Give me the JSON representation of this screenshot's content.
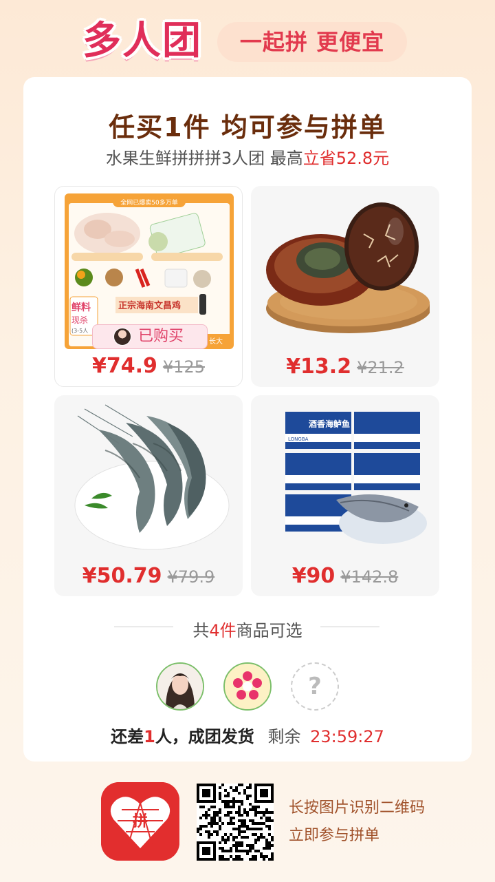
{
  "header": {
    "logo": "多人团",
    "slogan": "一起拼 更便宜"
  },
  "title": "任买1件 均可参与拼单",
  "subtitle": {
    "prefix": "水果生鲜拼拼拼3人团 最高",
    "highlight": "立省52.8元"
  },
  "products": [
    {
      "name": "chicken-combo",
      "price": "¥74.9",
      "original": "¥125",
      "bought_label": "已购买",
      "selected": true,
      "banner": "全网已爆卖50多万单",
      "tag1": "鲜料",
      "tag2": "现杀",
      "tag3": "(3-5人",
      "tag4": "长大",
      "product_title": "正宗海南文昌鸡"
    },
    {
      "name": "preserved-egg",
      "price": "¥13.2",
      "original": "¥21.2"
    },
    {
      "name": "shrimp",
      "price": "¥50.79",
      "original": "¥79.9"
    },
    {
      "name": "sea-bass",
      "price": "¥90",
      "original": "¥142.8",
      "box_label": "酒香海鲈鱼",
      "box_code": "LONGBA"
    }
  ],
  "count": {
    "prefix": "共",
    "num": "4件",
    "suffix": "商品可选"
  },
  "members": [
    {
      "type": "avatar-girl"
    },
    {
      "type": "avatar-flower"
    },
    {
      "type": "placeholder",
      "symbol": "?"
    }
  ],
  "status": {
    "need_prefix": "还差",
    "need_num": "1",
    "need_suffix": "人，成团发货",
    "remain_label": "剩余",
    "timer": "23:59:27"
  },
  "footer": {
    "app_icon_text": "拼",
    "line1": "长按图片识别二维码",
    "line2": "立即参与拼单"
  },
  "colors": {
    "accent": "#e02e2e",
    "brand_pink": "#e02e5a",
    "title_brown": "#6a2d0c"
  }
}
